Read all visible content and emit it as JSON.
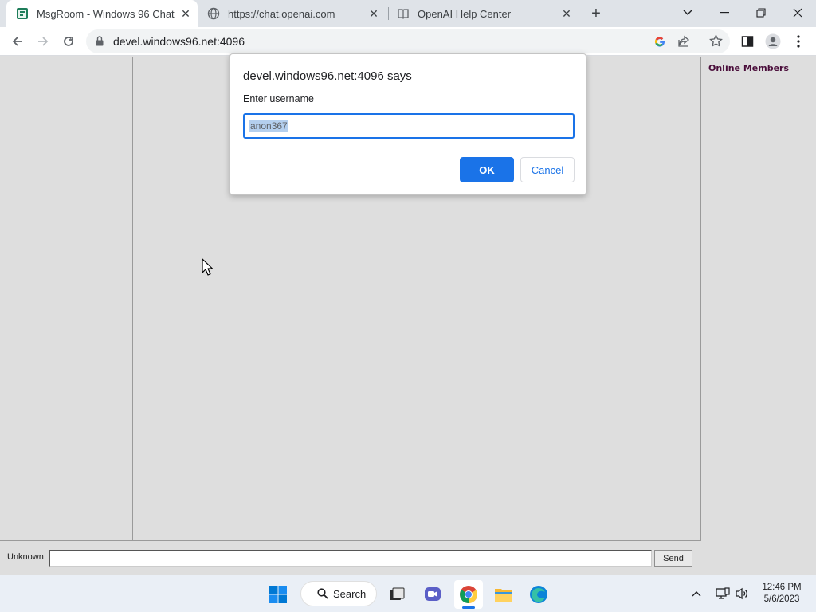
{
  "tabs": [
    {
      "title": "MsgRoom - Windows 96 Chat",
      "icon": "msgroom-icon",
      "active": true
    },
    {
      "title": "https://chat.openai.com",
      "icon": "globe-icon",
      "active": false
    },
    {
      "title": "OpenAI Help Center",
      "icon": "book-icon",
      "active": false
    }
  ],
  "address_bar": {
    "url": "devel.windows96.net:4096"
  },
  "chat": {
    "members_title": "Online Members",
    "username": "Unknown",
    "message_value": "",
    "send_label": "Send"
  },
  "dialog": {
    "title": "devel.windows96.net:4096 says",
    "prompt": "Enter username",
    "input_value": "anon367",
    "ok_label": "OK",
    "cancel_label": "Cancel"
  },
  "taskbar": {
    "search_label": "Search",
    "time": "12:46 PM",
    "date": "5/6/2023"
  },
  "colors": {
    "accent": "#1a73e8",
    "page_bg": "#dedede",
    "members_title": "#4a0d3a"
  }
}
